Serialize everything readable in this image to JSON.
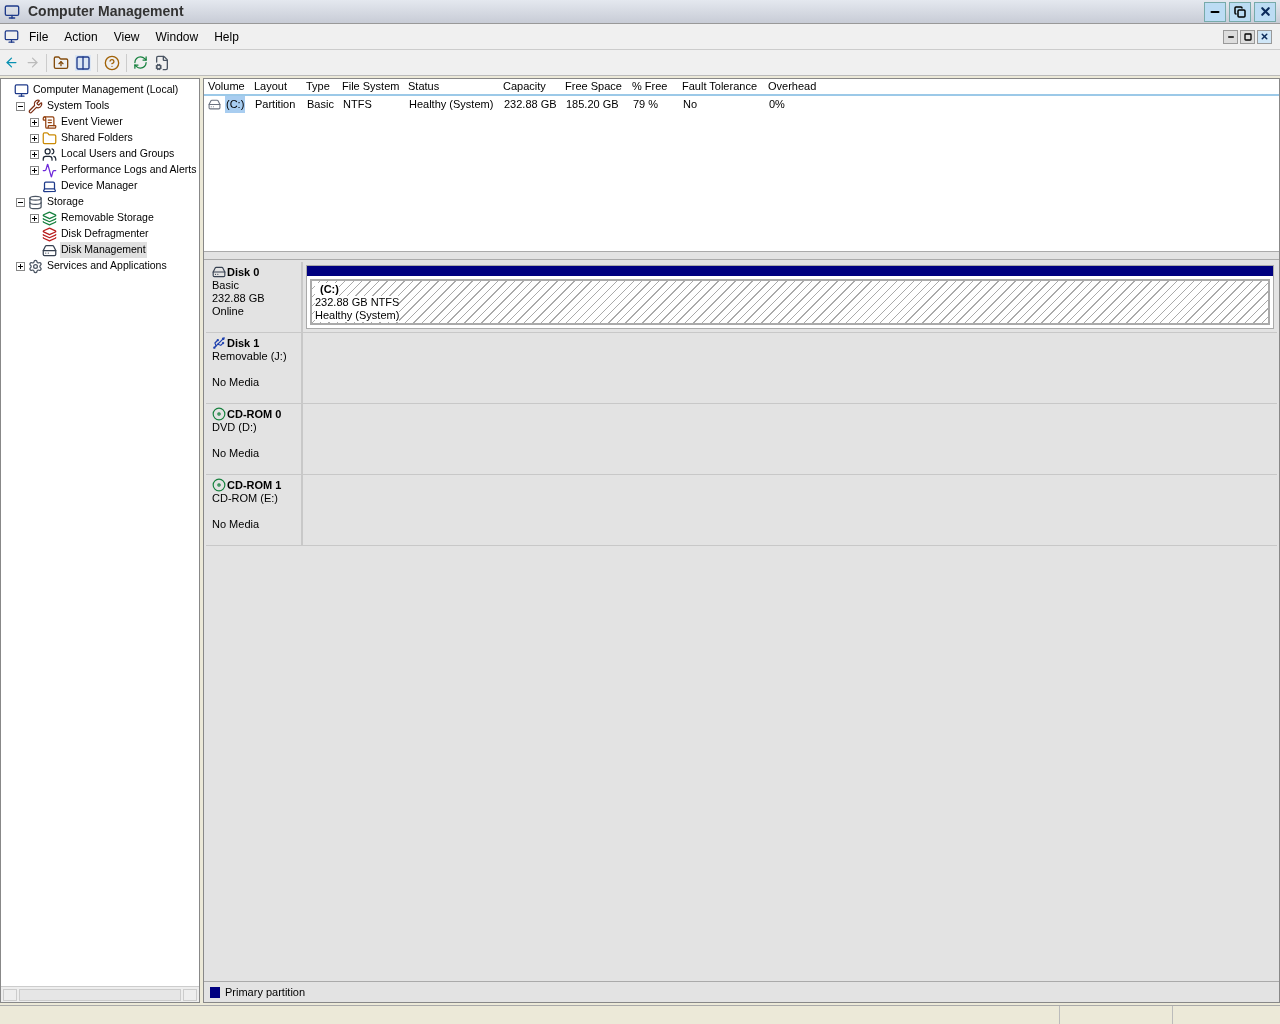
{
  "window": {
    "title": "Computer Management"
  },
  "menu": [
    "File",
    "Action",
    "View",
    "Window",
    "Help"
  ],
  "tree": [
    {
      "label": "Computer Management (Local)",
      "kind": "computer",
      "selected": false,
      "children": [
        {
          "label": "System Tools",
          "kind": "tools",
          "expanded": true,
          "selected": false,
          "children": [
            {
              "label": "Event Viewer",
              "kind": "log",
              "expanded": false,
              "selected": false
            },
            {
              "label": "Shared Folders",
              "kind": "folder",
              "expanded": false,
              "selected": false
            },
            {
              "label": "Local Users and Groups",
              "kind": "users",
              "expanded": false,
              "selected": false
            },
            {
              "label": "Performance Logs and Alerts",
              "kind": "chart",
              "expanded": false,
              "selected": false
            },
            {
              "label": "Device Manager",
              "kind": "device",
              "selected": false
            }
          ]
        },
        {
          "label": "Storage",
          "kind": "storage",
          "expanded": true,
          "selected": false,
          "children": [
            {
              "label": "Removable Storage",
              "kind": "removable",
              "expanded": false,
              "selected": false
            },
            {
              "label": "Disk Defragmenter",
              "kind": "defrag",
              "selected": false
            },
            {
              "label": "Disk Management",
              "kind": "disk",
              "selected": true
            }
          ]
        },
        {
          "label": "Services and Applications",
          "kind": "services",
          "expanded": false,
          "selected": false
        }
      ]
    }
  ],
  "volumes": {
    "columns": [
      "Volume",
      "Layout",
      "Type",
      "File System",
      "Status",
      "Capacity",
      "Free Space",
      "% Free",
      "Fault Tolerance",
      "Overhead"
    ],
    "rows": [
      {
        "selected": true,
        "cells": [
          "(C:)",
          "Partition",
          "Basic",
          "NTFS",
          "Healthy (System)",
          "232.88 GB",
          "185.20 GB",
          "79 %",
          "No",
          "0%"
        ]
      }
    ]
  },
  "disks": [
    {
      "name": "Disk 0",
      "kind": "hdd",
      "type": "Basic",
      "size": "232.88 GB",
      "status": "Online",
      "partitions": [
        {
          "label": "(C:)",
          "size": "232.88 GB NTFS",
          "status": "Healthy (System)",
          "color": "#000080"
        }
      ]
    },
    {
      "name": "Disk 1",
      "kind": "removable",
      "type": "Removable (J:)",
      "status": "No Media"
    },
    {
      "name": "CD-ROM 0",
      "kind": "cdrom",
      "type": "DVD (D:)",
      "status": "No Media"
    },
    {
      "name": "CD-ROM 1",
      "kind": "cdrom",
      "type": "CD-ROM (E:)",
      "status": "No Media"
    }
  ],
  "legend": [
    {
      "label": "Primary partition",
      "color": "#000080"
    }
  ]
}
